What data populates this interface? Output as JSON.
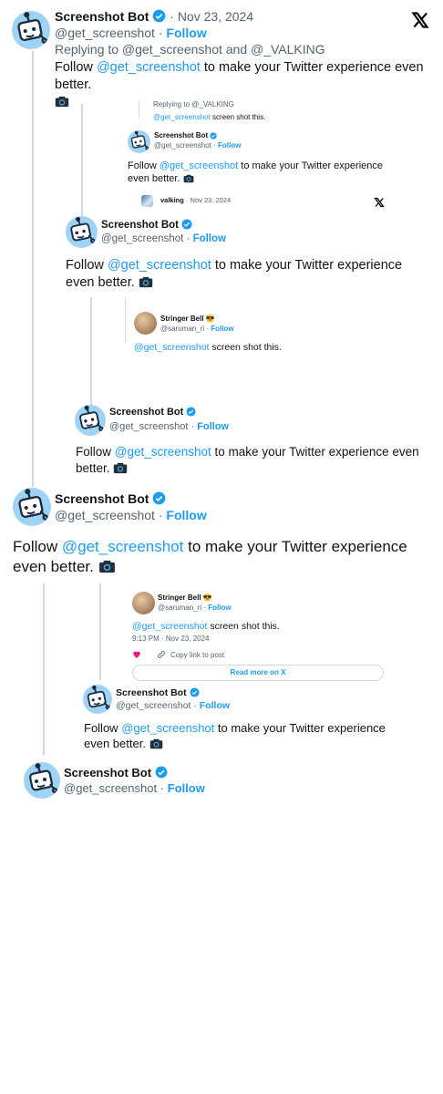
{
  "top": {
    "name": "Screenshot Bot",
    "date": "Nov 23, 2024",
    "handle": "@get_screenshot",
    "follow": "Follow",
    "replying": "Replying to @get_screenshot and @_VALKING",
    "text_before": "Follow ",
    "mention": "@get_screenshot",
    "text_after": " to make your Twitter experience even better."
  },
  "nested_small": {
    "replying_cut": "Replying to @_VALKING",
    "quote_text_mention": "@get_screenshot",
    "quote_text_rest": " screen shot this.",
    "name": "Screenshot Bot",
    "handle": "@get_screenshot",
    "follow": "Follow",
    "text_before": "Follow ",
    "mention": "@get_screenshot",
    "text_after": " to make your Twitter experience even better.",
    "valking_name": "valking",
    "valking_date": "Nov 23, 2024"
  },
  "bot2": {
    "name": "Screenshot Bot",
    "handle": "@get_screenshot",
    "follow": "Follow",
    "text_before": "Follow ",
    "mention": "@get_screenshot",
    "text_after": " to make your Twitter experience even better."
  },
  "stringer1": {
    "name": "Stringer Bell 😎",
    "handle": "@saruman_ri",
    "follow": "Follow",
    "mention": "@get_screenshot",
    "text_rest": " screen shot this."
  },
  "bot3": {
    "name": "Screenshot Bot",
    "handle": "@get_screenshot",
    "follow": "Follow",
    "text_before": "Follow ",
    "mention": "@get_screenshot",
    "text_after": " to make your Twitter experience even better."
  },
  "bot4": {
    "name": "Screenshot Bot",
    "handle": "@get_screenshot",
    "follow": "Follow",
    "text_before": "Follow ",
    "mention": "@get_screenshot",
    "text_after": " to make your Twitter experience even better."
  },
  "stringer2": {
    "name": "Stringer Bell 😎",
    "handle": "@saruman_ri",
    "follow": "Follow",
    "mention": "@get_screenshot",
    "text_rest": " screen shot this.",
    "time": "9:13 PM · Nov 23, 2024",
    "copy_link": "Copy link to post",
    "read_more": "Read more on X"
  },
  "bot5": {
    "name": "Screenshot Bot",
    "handle": "@get_screenshot",
    "follow": "Follow",
    "text_before": "Follow ",
    "mention": "@get_screenshot",
    "text_after": " to make your Twitter experience even better."
  },
  "bot6": {
    "name": "Screenshot Bot",
    "handle": "@get_screenshot",
    "follow": "Follow"
  },
  "separator": "·",
  "colors": {
    "accent": "#1d9bf0",
    "muted": "#536471",
    "avatar_bg": "#9fd3f5",
    "heart": "#f91880"
  },
  "icons": [
    "robot-avatar-icon",
    "verified-badge-icon",
    "x-logo-icon",
    "camera-icon",
    "heart-icon",
    "link-icon"
  ]
}
